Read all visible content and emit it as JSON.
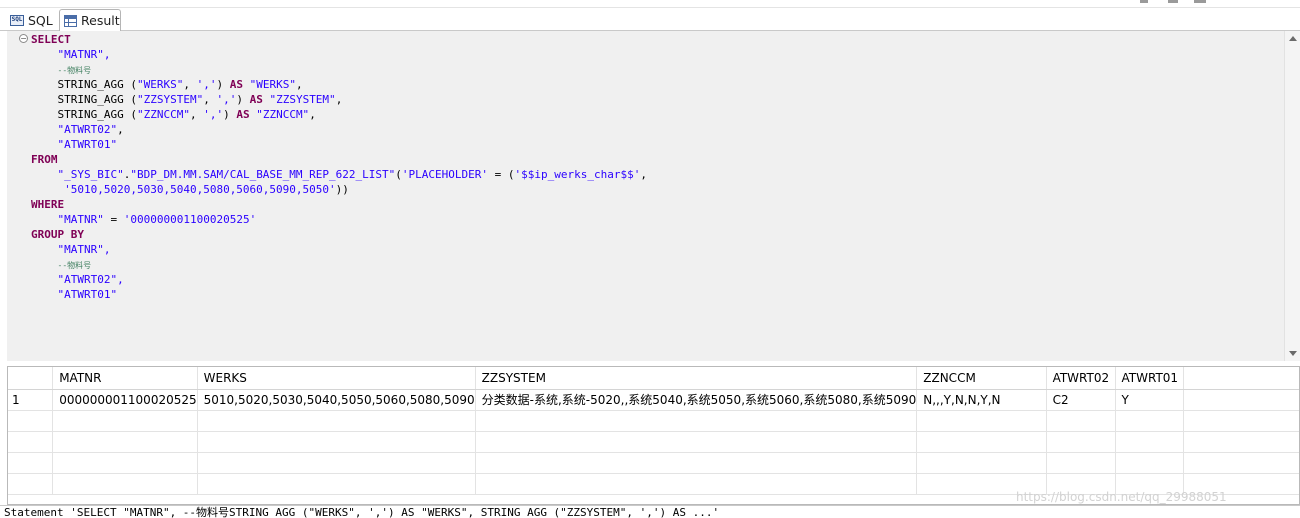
{
  "tabs": [
    {
      "label": "SQL",
      "icon": "sql-icon",
      "active": false
    },
    {
      "label": "Result",
      "icon": "table-icon",
      "active": true
    }
  ],
  "editor": {
    "lines": [
      [
        {
          "t": "SELECT",
          "c": "kw"
        }
      ],
      [
        {
          "t": "    "
        },
        {
          "t": "\"MATNR\",",
          "c": "str"
        }
      ],
      [
        {
          "t": "    "
        },
        {
          "t": "--物料号",
          "c": "cmt"
        }
      ],
      [
        {
          "t": "    STRING_AGG ("
        },
        {
          "t": "\"WERKS\"",
          "c": "str"
        },
        {
          "t": ", "
        },
        {
          "t": "','",
          "c": "str"
        },
        {
          "t": ") "
        },
        {
          "t": "AS",
          "c": "kw"
        },
        {
          "t": " "
        },
        {
          "t": "\"WERKS\"",
          "c": "str"
        },
        {
          "t": ","
        }
      ],
      [
        {
          "t": "    STRING_AGG ("
        },
        {
          "t": "\"ZZSYSTEM\"",
          "c": "str"
        },
        {
          "t": ", "
        },
        {
          "t": "','",
          "c": "str"
        },
        {
          "t": ") "
        },
        {
          "t": "AS",
          "c": "kw"
        },
        {
          "t": " "
        },
        {
          "t": "\"ZZSYSTEM\"",
          "c": "str"
        },
        {
          "t": ","
        }
      ],
      [
        {
          "t": "    STRING_AGG ("
        },
        {
          "t": "\"ZZNCCM\"",
          "c": "str"
        },
        {
          "t": ", "
        },
        {
          "t": "','",
          "c": "str"
        },
        {
          "t": ") "
        },
        {
          "t": "AS",
          "c": "kw"
        },
        {
          "t": " "
        },
        {
          "t": "\"ZZNCCM\"",
          "c": "str"
        },
        {
          "t": ","
        }
      ],
      [
        {
          "t": "    "
        },
        {
          "t": "\"ATWRT02\"",
          "c": "str"
        },
        {
          "t": ","
        }
      ],
      [
        {
          "t": "    "
        },
        {
          "t": "\"ATWRT01\"",
          "c": "str"
        }
      ],
      [
        {
          "t": "FROM",
          "c": "kw"
        }
      ],
      [
        {
          "t": "    "
        },
        {
          "t": "\"_SYS_BIC\"",
          "c": "str"
        },
        {
          "t": "."
        },
        {
          "t": "\"BDP_DM.MM.SAM/CAL_BASE_MM_REP_622_LIST\"",
          "c": "str"
        },
        {
          "t": "("
        },
        {
          "t": "'PLACEHOLDER'",
          "c": "str"
        },
        {
          "t": " = ("
        },
        {
          "t": "'$$ip_werks_char$$'",
          "c": "str"
        },
        {
          "t": ","
        }
      ],
      [
        {
          "t": "     "
        },
        {
          "t": "'5010,5020,5030,5040,5080,5060,5090,5050'",
          "c": "str"
        },
        {
          "t": "))"
        }
      ],
      [
        {
          "t": "WHERE",
          "c": "kw"
        }
      ],
      [
        {
          "t": "    "
        },
        {
          "t": "\"MATNR\"",
          "c": "str"
        },
        {
          "t": " = "
        },
        {
          "t": "'000000001100020525'",
          "c": "str"
        }
      ],
      [
        {
          "t": "GROUP BY",
          "c": "kw"
        }
      ],
      [
        {
          "t": "    "
        },
        {
          "t": "\"MATNR\",",
          "c": "str"
        }
      ],
      [
        {
          "t": "    "
        },
        {
          "t": "--物料号",
          "c": "cmt"
        }
      ],
      [
        {
          "t": "    "
        },
        {
          "t": "\"ATWRT02\",",
          "c": "str"
        }
      ],
      [
        {
          "t": "    "
        },
        {
          "t": "\"ATWRT01\"",
          "c": "str"
        }
      ]
    ]
  },
  "results": {
    "columns": [
      "",
      "MATNR",
      "WERKS",
      "ZZSYSTEM",
      "ZZNCCM",
      "ATWRT02",
      "ATWRT01"
    ],
    "rows": [
      [
        "1",
        "000000001100020525",
        "5010,5020,5030,5040,5050,5060,5080,5090",
        "分类数据-系统,系统-5020,,系统5040,系统5050,系统5060,系统5080,系统5090",
        "N,,,Y,N,N,Y,N",
        "C2",
        "Y"
      ]
    ],
    "empty_rows": 4
  },
  "status": {
    "text": "Statement 'SELECT \"MATNR\", --物料号STRING_AGG (\"WERKS\", ',') AS \"WERKS\", STRING_AGG (\"ZZSYSTEM\", ',') AS ...'"
  },
  "watermark": "https://blog.csdn.net/qq_29988051"
}
